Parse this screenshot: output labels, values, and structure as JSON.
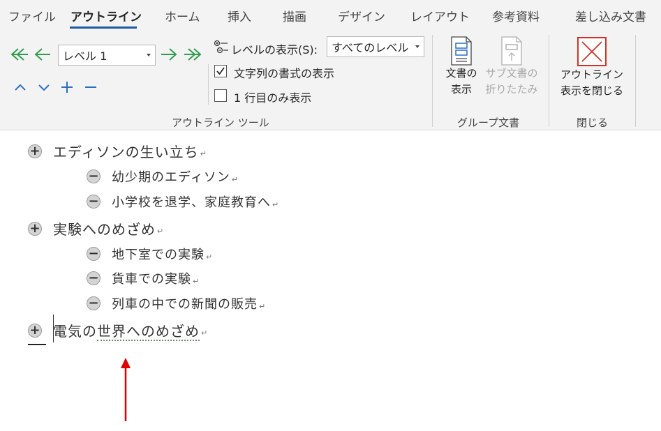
{
  "tabs": [
    {
      "label": "ファイル",
      "active": false
    },
    {
      "label": "アウトライン",
      "active": true
    },
    {
      "label": "ホーム",
      "active": false
    },
    {
      "label": "挿入",
      "active": false
    },
    {
      "label": "描画",
      "active": false
    },
    {
      "label": "デザイン",
      "active": false
    },
    {
      "label": "レイアウト",
      "active": false
    },
    {
      "label": "参考資料",
      "active": false
    },
    {
      "label": "差し込み文書",
      "active": false
    }
  ],
  "outline_tools": {
    "level_combo_value": "レベル 1",
    "show_level_label": "レベルの表示(S):",
    "show_level_value": "すべてのレベル",
    "show_formatting_label": "文字列の書式の表示",
    "show_formatting_checked": true,
    "first_line_only_label": "1 行目のみ表示",
    "first_line_only_checked": false,
    "group_label": "アウトライン ツール"
  },
  "master_document": {
    "show_document_line1": "文書の",
    "show_document_line2": "表示",
    "collapse_sub_line1": "サブ文書の",
    "collapse_sub_line2": "折りたたみ",
    "group_label": "グループ文書"
  },
  "close": {
    "close_outline_line1": "アウトライン",
    "close_outline_line2": "表示を閉じる",
    "group_label": "閉じる"
  },
  "colors": {
    "arrow_green": "#2f9e4f",
    "arrow_blue": "#2a6fc1",
    "close_red": "#d93025",
    "tab_underline": "#1a5aa8",
    "annotation_arrow": "#e00000"
  },
  "icons": [
    "promote-to-heading1-icon",
    "promote-icon",
    "demote-icon",
    "demote-to-body-icon",
    "move-up-icon",
    "move-down-icon",
    "expand-icon",
    "collapse-icon",
    "show-level-icon",
    "show-document-icon",
    "collapse-subdocuments-icon",
    "close-outline-icon",
    "expand-symbol-icon",
    "collapse-symbol-icon"
  ],
  "outline": [
    {
      "symbol": "+",
      "text": "エディソンの生い立ち",
      "level": 1
    },
    {
      "symbol": "−",
      "text": "幼少期のエディソン",
      "level": 2
    },
    {
      "symbol": "−",
      "text": "小学校を退学、家庭教育へ",
      "level": 2
    },
    {
      "symbol": "+",
      "text": "実験へのめざめ",
      "level": 1
    },
    {
      "symbol": "−",
      "text": "地下室での実験",
      "level": 2
    },
    {
      "symbol": "−",
      "text": "貨車での実験",
      "level": 2
    },
    {
      "symbol": "−",
      "text": "列車の中での新聞の販売",
      "level": 2
    },
    {
      "symbol": "+",
      "text_part1": "電気の",
      "text_part2": "世界へのめざめ",
      "level": 1
    }
  ],
  "paragraph_mark": "↵"
}
